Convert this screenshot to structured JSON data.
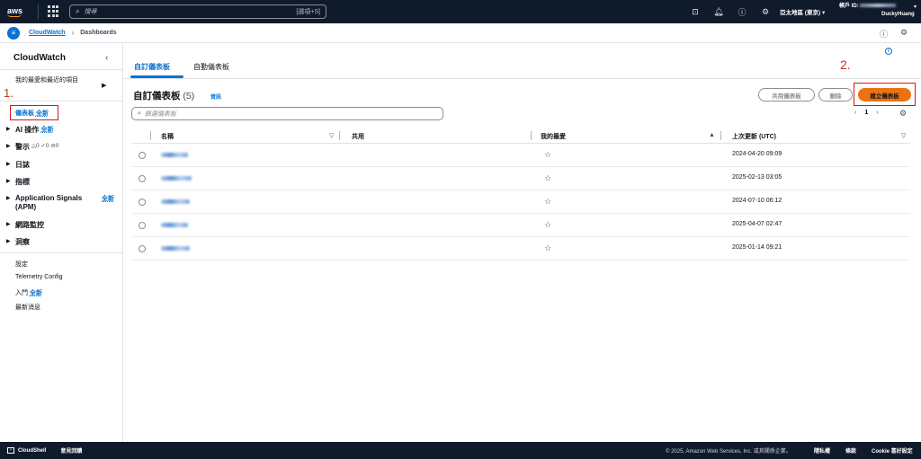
{
  "topbar": {
    "logo": "aws",
    "search_placeholder": "搜尋",
    "search_shortcut": "[選項+S]",
    "region": "亞太地區 (東京) ▾",
    "account_label": "帳戶 ID:",
    "account_user": "DuckyHuang",
    "icons": [
      "cloudshell-icon",
      "bell-icon",
      "help-icon",
      "gear-icon"
    ]
  },
  "breadcrumb": {
    "root": "CloudWatch",
    "current": "Dashboards"
  },
  "sidebar": {
    "title": "CloudWatch",
    "favorites": "我的最愛和最近的項目",
    "step_marker": "1.",
    "dashboards": "儀表板",
    "new_badge": "全新",
    "items": [
      {
        "label": "AI 操作",
        "badge": "全新"
      },
      {
        "label": "警示",
        "alarm_counts": [
          "0",
          "0",
          "0"
        ]
      },
      {
        "label": "日誌"
      },
      {
        "label": "指標"
      },
      {
        "label": "Application Signals (APM)",
        "badge": "全新"
      },
      {
        "label": "網路監控"
      },
      {
        "label": "洞察"
      }
    ],
    "bottom_links": [
      {
        "label": "設定"
      },
      {
        "label": "Telemetry Config"
      },
      {
        "label": "入門",
        "badge": "全新"
      },
      {
        "label": "最新消息"
      }
    ]
  },
  "tabs": {
    "custom": "自訂儀表板",
    "automatic": "自動儀表板"
  },
  "header": {
    "title": "自訂儀表板",
    "count": "(5)",
    "info": "資訊",
    "step_marker": "2.",
    "share_button": "共用儀表板",
    "delete_button": "刪除",
    "create_button": "建立儀表板"
  },
  "filter": {
    "placeholder": "篩選儀表板"
  },
  "pagination": {
    "prev": "‹",
    "page": "1",
    "next": "›"
  },
  "table": {
    "columns": [
      "名稱",
      "共用",
      "我的最愛",
      "上次更新 (UTC)"
    ],
    "rows": [
      {
        "updated": "2024-04-20 09:09"
      },
      {
        "updated": "2025-02-13 03:05"
      },
      {
        "updated": "2024-07-10 06:12"
      },
      {
        "updated": "2025-04-07 02:47"
      },
      {
        "updated": "2025-01-14 09:21"
      }
    ]
  },
  "footer": {
    "cloudshell": "CloudShell",
    "feedback": "意見回饋",
    "copyright": "© 2025, Amazon Web Services, Inc. 或其關係企業。",
    "privacy": "隱私權",
    "terms": "條款",
    "cookie": "Cookie 喜好設定"
  },
  "colors": {
    "accent": "#0972d3",
    "primary_button": "#ec7211",
    "annotation": "#d91515",
    "topbar": "#0f1b2a"
  }
}
